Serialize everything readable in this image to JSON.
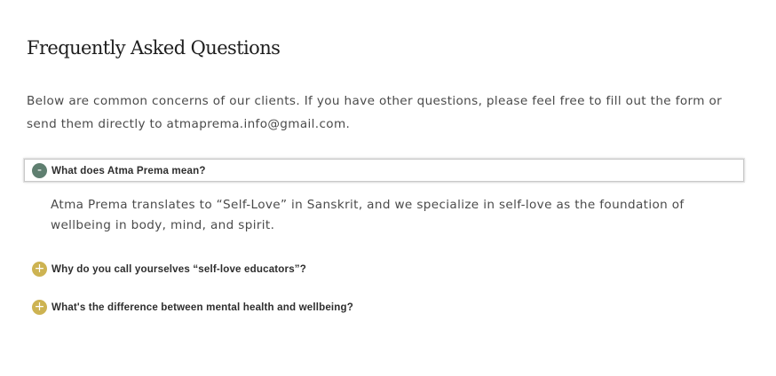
{
  "faq": {
    "title": "Frequently Asked Questions",
    "intro": "Below are common concerns of our clients. If you have other questions, please feel free to fill out the form or send them directly to atmaprema.info@gmail.com.",
    "items": [
      {
        "icon": "minus-icon",
        "icon_glyph": "-",
        "question": "What does Atma Prema mean?",
        "answer": "Atma Prema translates to “Self-Love” in Sanskrit, and we specialize in self-love as the foundation of wellbeing in body, mind, and spirit.",
        "expanded": true
      },
      {
        "icon": "plus-icon",
        "icon_glyph": "+",
        "question": "Why do you call yourselves “self-love educators”?",
        "expanded": false
      },
      {
        "icon": "plus-icon",
        "icon_glyph": "+",
        "question": "What's the difference between mental health and wellbeing?",
        "expanded": false
      }
    ]
  },
  "colors": {
    "expanded_icon": "#5f7f70",
    "collapsed_icon": "#cdb352"
  }
}
